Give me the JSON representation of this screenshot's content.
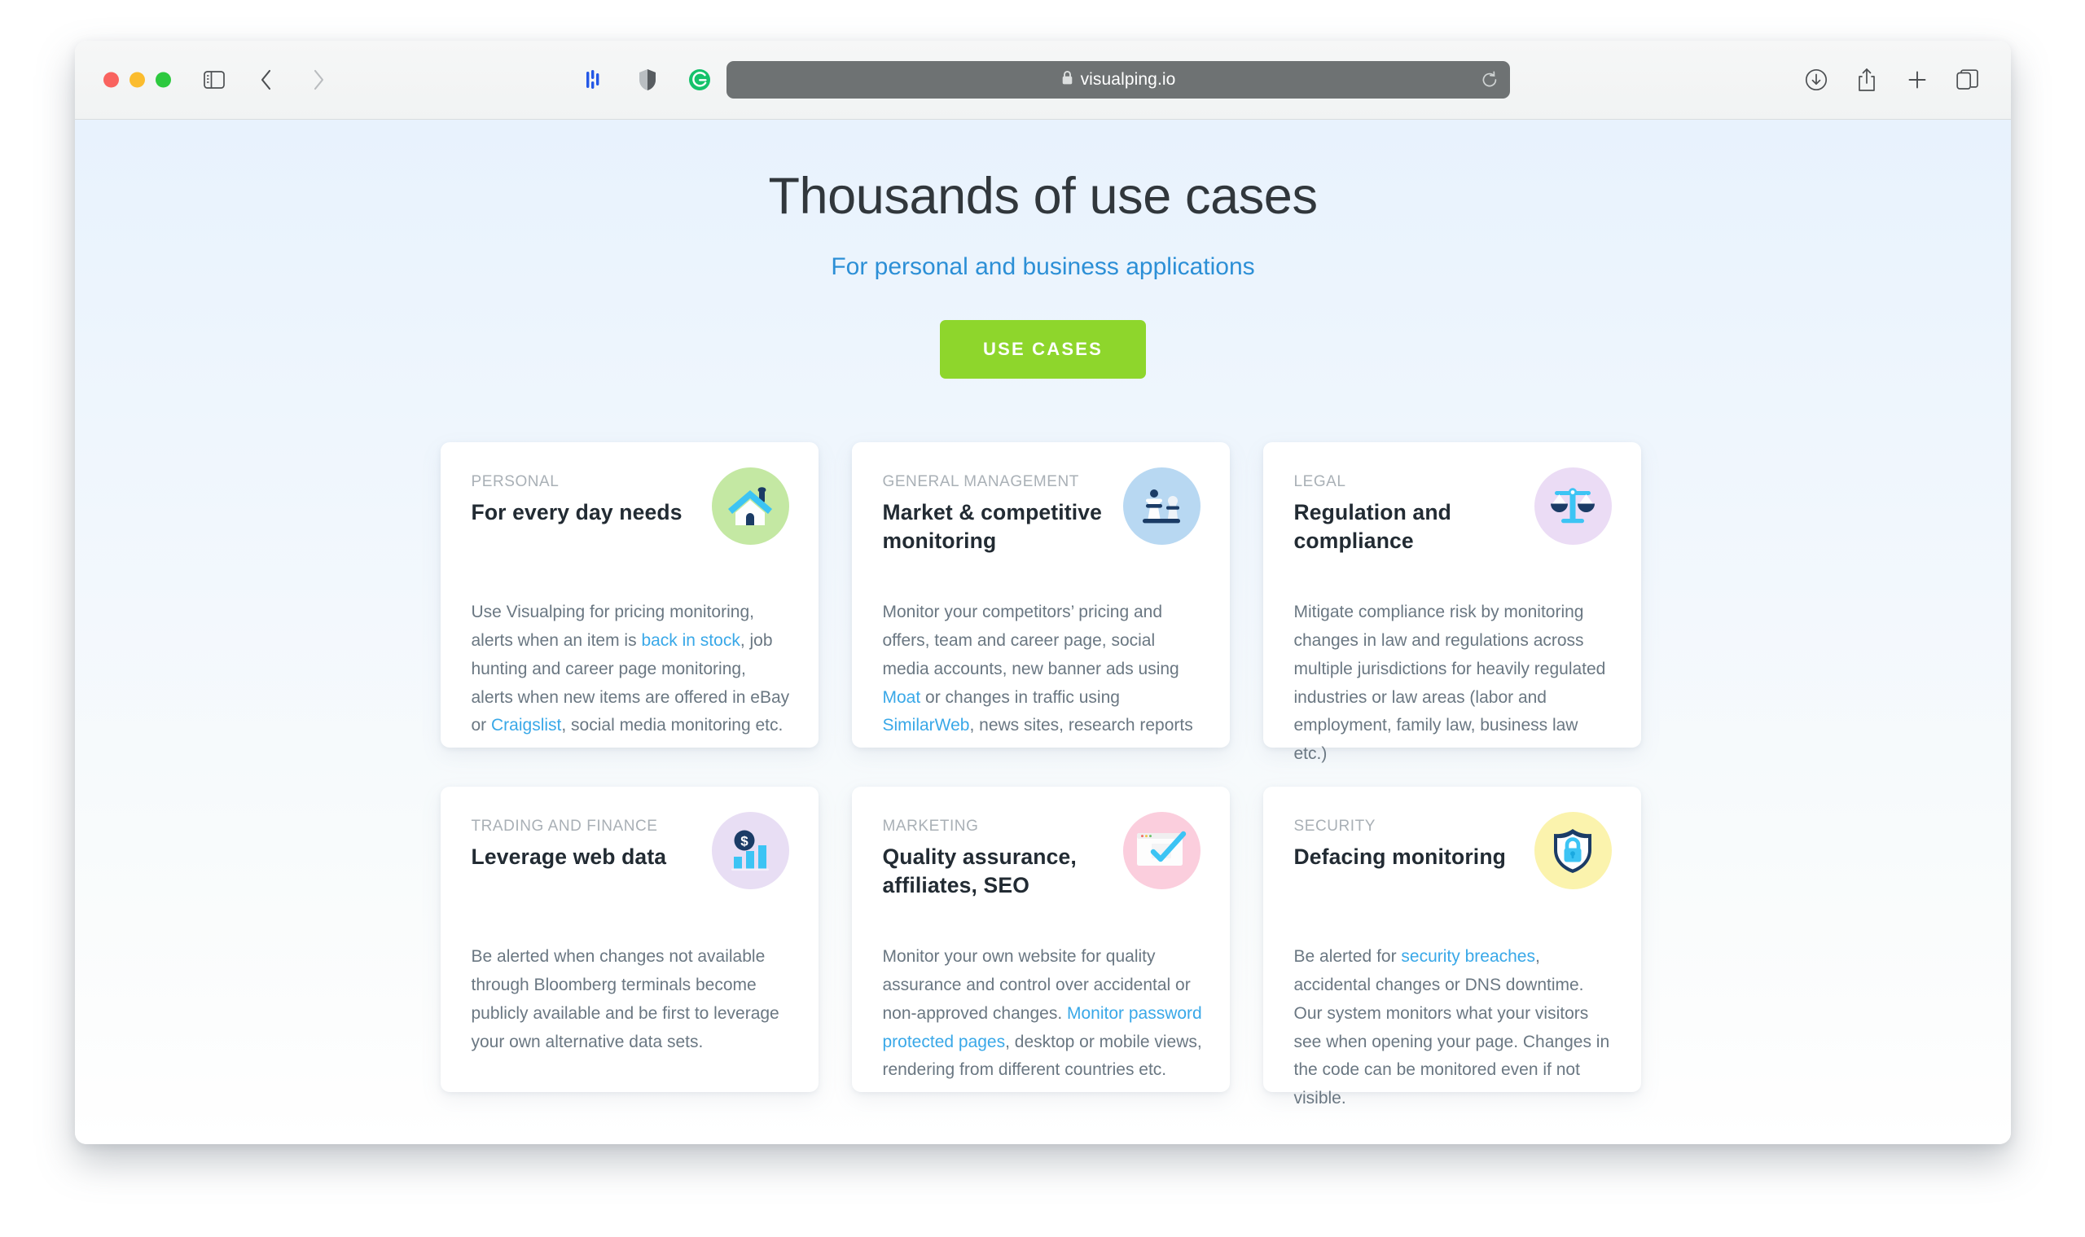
{
  "browser": {
    "url": "visualping.io",
    "lock_icon": "lock-icon",
    "traffic_lights": [
      "close",
      "minimize",
      "maximize"
    ],
    "toolbar_icons": [
      "sidebar-icon",
      "back-icon",
      "forward-icon",
      "onepassword-extension-icon",
      "privacy-shield-extension-icon",
      "grammarly-extension-icon",
      "reload-icon",
      "downloads-icon",
      "share-icon",
      "new-tab-icon",
      "tab-overview-icon"
    ]
  },
  "hero": {
    "title": "Thousands of use cases",
    "subtitle": "For personal and business applications",
    "cta_label": "USE CASES"
  },
  "cards": [
    {
      "eyebrow": "PERSONAL",
      "title": "For every day needs",
      "icon": "house-icon",
      "icon_class": "ic-personal",
      "body_html": "Use Visualping for pricing monitoring, alerts when an item is <a href=\"#\" data-name=\"link-back-in-stock\" data-interactable=\"true\">back in stock</a>, job hunting and career page monitoring, alerts when new items are offered in eBay or <a href=\"#\" data-name=\"link-craigslist\" data-interactable=\"true\">Craigslist</a>, social media monitoring etc."
    },
    {
      "eyebrow": "GENERAL MANAGEMENT",
      "title": "Market & competitive monitoring",
      "icon": "chess-pieces-icon",
      "icon_class": "ic-general",
      "body_html": "Monitor your competitors’ pricing and offers, team and career page, social media accounts, new banner ads using <a href=\"#\" data-name=\"link-moat\" data-interactable=\"true\">Moat</a> or changes in traffic using <a href=\"#\" data-name=\"link-similarweb\" data-interactable=\"true\">SimilarWeb</a>, news sites, research reports"
    },
    {
      "eyebrow": "LEGAL",
      "title": "Regulation and compliance",
      "icon": "scales-of-justice-icon",
      "icon_class": "ic-legal",
      "body_html": "Mitigate compliance risk by monitoring changes in law and regulations across multiple jurisdictions for heavily regulated industries or law areas (labor and employment, family law, business law etc.)"
    },
    {
      "eyebrow": "TRADING AND FINANCE",
      "title": "Leverage web data",
      "icon": "dollar-bar-chart-icon",
      "icon_class": "ic-trading",
      "body_html": "Be alerted when changes not available through Bloomberg terminals become publicly available and be first to leverage your own alternative data sets."
    },
    {
      "eyebrow": "MARKETING",
      "title": "Quality assurance, affiliates, SEO",
      "icon": "browser-checkmark-icon",
      "icon_class": "ic-marketing",
      "body_html": "Monitor your own website for quality assurance and control over accidental or non-approved changes. <a href=\"#\" data-name=\"link-monitor-password-protected-pages\" data-interactable=\"true\">Monitor password protected pages</a>, desktop or mobile views, rendering from different countries etc."
    },
    {
      "eyebrow": "SECURITY",
      "title": "Defacing monitoring",
      "icon": "shield-lock-icon",
      "icon_class": "ic-security",
      "body_html": "Be alerted for <a href=\"#\" data-name=\"link-security-breaches\" data-interactable=\"true\">security breaches</a>, accidental changes or DNS downtime. Our system monitors what your visitors see when opening your page. Changes in the code can be monitored even if not visible."
    }
  ],
  "colors": {
    "cta_green": "#8ed62c",
    "link_blue": "#39a8e8",
    "subtitle_blue": "#2c8fd6",
    "icon_navy": "#1b3c66",
    "icon_cyan": "#3cc4f4"
  }
}
